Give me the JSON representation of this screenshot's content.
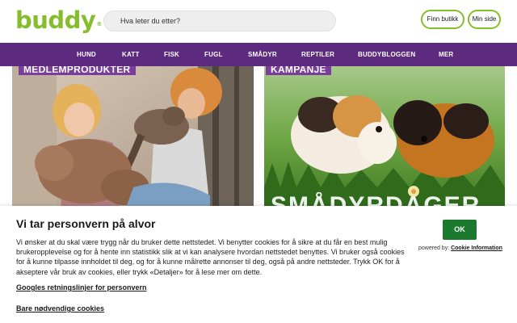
{
  "header": {
    "logo_text": "buddy",
    "logo_reg": "®",
    "search_placeholder": "Hva leter du etter?",
    "find_store_label": "Finn butikk",
    "my_page_label": "Min side"
  },
  "nav": {
    "items": [
      "Hund",
      "Katt",
      "Fisk",
      "Fugl",
      "Smådyr",
      "Reptiler",
      "Buddybloggen",
      "Mer"
    ]
  },
  "promos": [
    {
      "tag": "MEDLEMPRODUKTER",
      "image": "girl and woman hugging dog and cat"
    },
    {
      "tag": "KAMPANJE",
      "image": "two guinea pigs on grass",
      "overlay_text": "SMÅDYRDAGER"
    }
  ],
  "cookie": {
    "title": "Vi tar personvern på alvor",
    "body": "Vi ønsker at du skal være trygg når du bruker dette nettstedet. Vi benytter cookies for å sikre at du får en best mulig brukeropplevelse og for å hente inn statistikk slik at vi kan analysere hvordan nettstedet benyttes. Vi bruker også cookies for å kunne tilpasse innholdet til deg, og for å kunne målrette annonser til deg, også på andre nettsteder. Trykk OK for å akseptere vår bruk av cookies, eller trykk «Detaljer» for å lese mer om dette.",
    "policy_link": "Googles retningslinjer for personvern",
    "necessary_link": "Bare nødvendige cookies",
    "ok_label": "OK",
    "powered_prefix": "powered by:",
    "powered_link": "Cookie Information"
  },
  "colors": {
    "brand_green": "#86bd2d",
    "nav_purple": "#5c2a7e",
    "tag_purple": "#7a3d9c",
    "ok_green": "#1b7a2e"
  }
}
